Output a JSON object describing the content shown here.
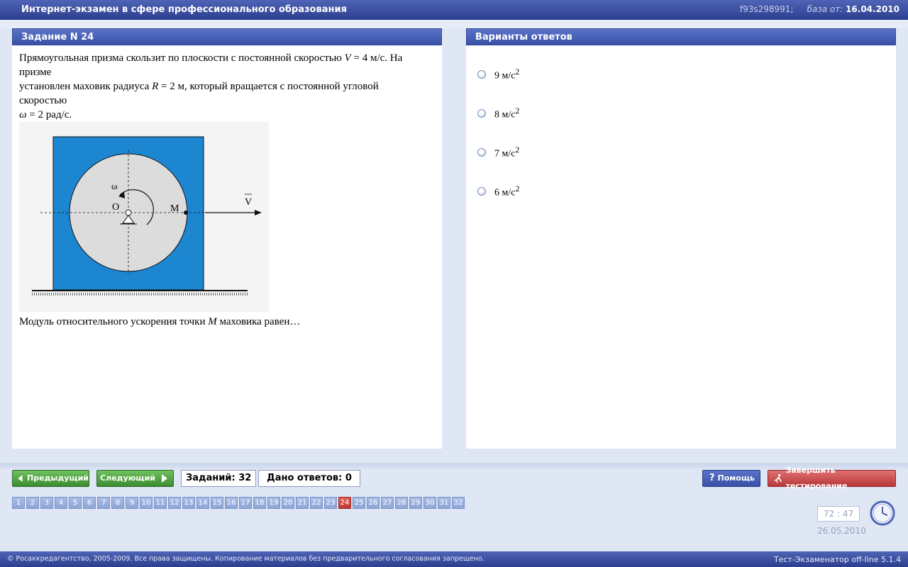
{
  "header": {
    "title": "Интернет-экзамен в сфере профессионального образования",
    "code": "f93s298991;",
    "base_label": "база от:",
    "base_date": "16.04.2010"
  },
  "task": {
    "title": "Задание N 24",
    "line1": "Прямоугольная призма скользит по плоскости с постоянной скоростью",
    "line1_var": "V",
    "line1_val": " = 4 м/с. На",
    "line2": "призме",
    "line3": "установлен маховик радиуса",
    "line3_var": "R",
    "line3_val": " = 2 м, который вращается с постоянной угловой",
    "line4": "скоростью",
    "line5_var": "ω",
    "line5_val": " = 2 рад/с.",
    "question": "Модуль относительного ускорения точки",
    "question_var": "M",
    "question_tail": " маховика равен…",
    "figure": {
      "label_omega": "ω",
      "label_o": "O",
      "label_m": "M",
      "label_v": "V"
    }
  },
  "answers": {
    "title": "Варианты ответов",
    "options": [
      {
        "value": "9",
        "unit": "м/с",
        "exp": "2"
      },
      {
        "value": "8",
        "unit": "м/с",
        "exp": "2"
      },
      {
        "value": "7",
        "unit": "м/с",
        "exp": "2"
      },
      {
        "value": "6",
        "unit": "м/с",
        "exp": "2"
      }
    ]
  },
  "nav": {
    "prev_label": "Предыдущий",
    "next_label": "Следующий",
    "tasks_count": "Заданий: 32",
    "answered_count": "Дано ответов: 0",
    "help_label": "Помощь",
    "finish_label": "Завершить тестирование",
    "pages": [
      "1",
      "2",
      "3",
      "4",
      "5",
      "6",
      "7",
      "8",
      "9",
      "10",
      "11",
      "12",
      "13",
      "14",
      "15",
      "16",
      "17",
      "18",
      "19",
      "20",
      "21",
      "22",
      "23",
      "24",
      "25",
      "26",
      "27",
      "28",
      "29",
      "30",
      "31",
      "32"
    ],
    "current_page": "24"
  },
  "timer": {
    "value": "72 : 47",
    "date": "26.05.2010"
  },
  "footer": {
    "copyright": "© Росаккредагентство, 2005-2009. Все права защищены. Копирование материалов без предварительного согласования запрещено.",
    "version": "Тест-Экзаменатор off-line 5.1.4"
  },
  "colors": {
    "accent": "#3850a6",
    "prism": "#1d86d1",
    "disk": "#dcdcdc",
    "active_page": "#c03733"
  }
}
